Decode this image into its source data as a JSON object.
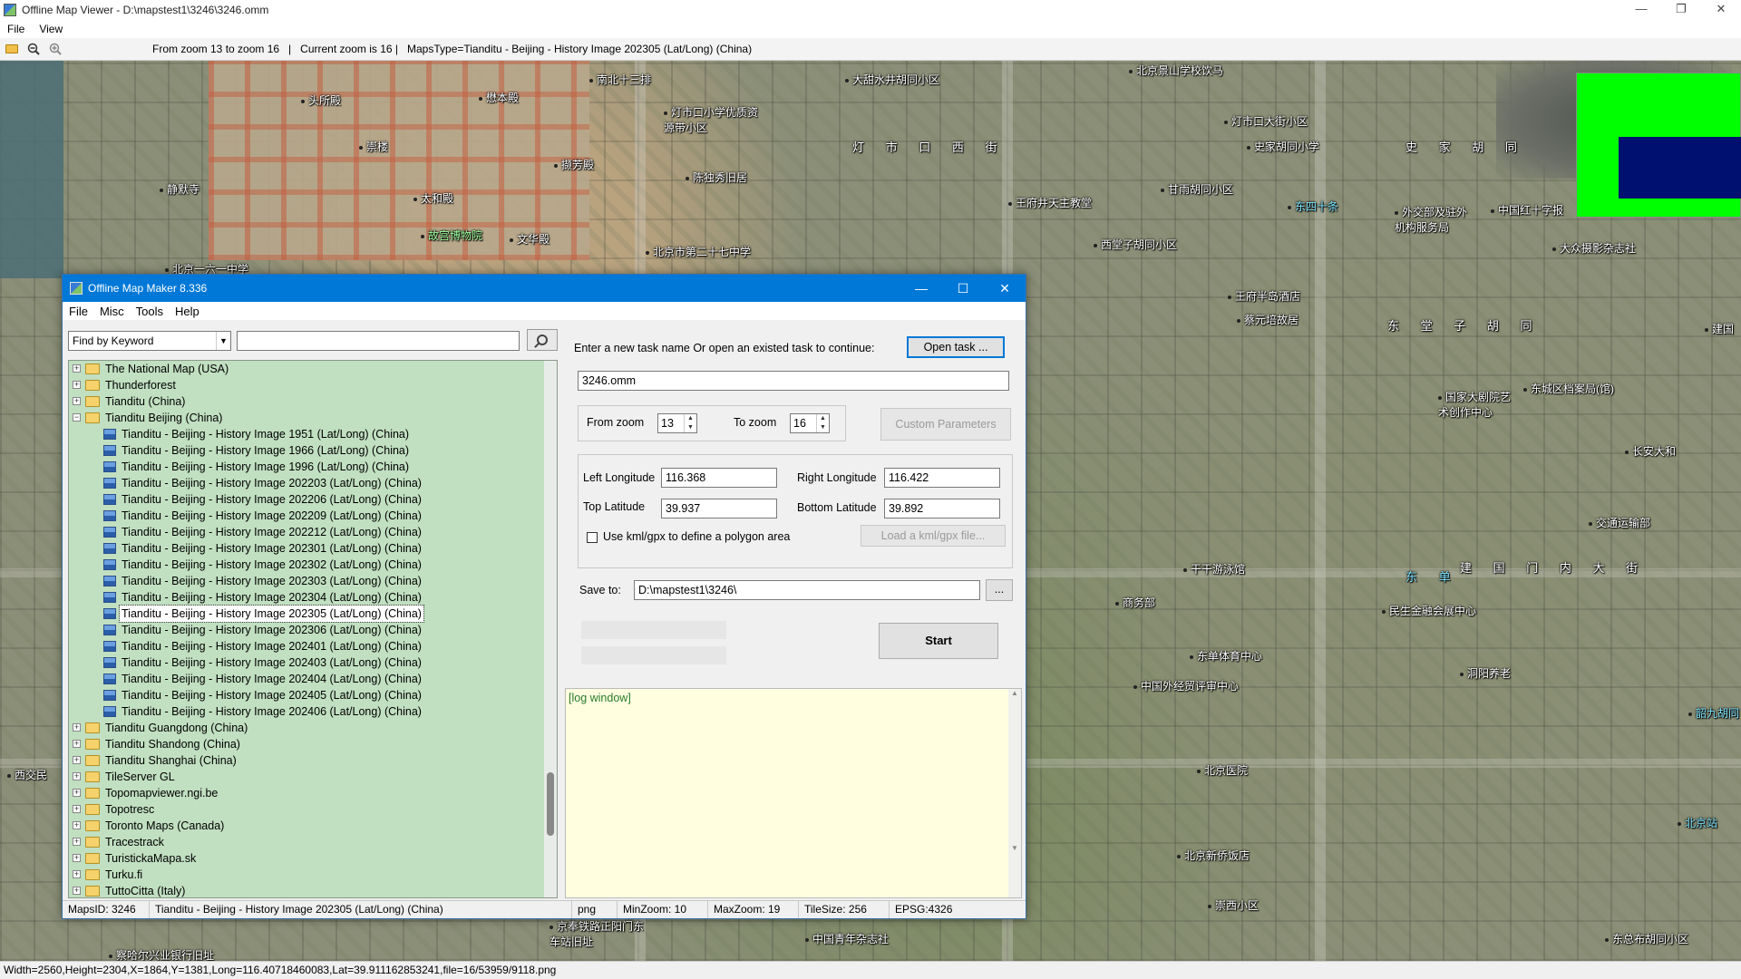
{
  "viewer": {
    "title": "Offline Map Viewer - D:\\mapstest1\\3246\\3246.omm",
    "window_buttons": [
      "—",
      "❐",
      "✕"
    ],
    "menu": [
      "File",
      "View"
    ],
    "toolbar_info": "From zoom 13 to zoom 16   |   Current zoom is 16 |   MapsType=Tianditu - Beijing - History Image 202305 (Lat/Long) (China)",
    "status": "Width=2560,Height=2304,X=1864,Y=1381,Long=116.40718460083,Lat=39.911162853241,file=16/53959/9118.png"
  },
  "map_labels": [
    "头所殿",
    "懋本殿",
    "崇楼",
    "静默寺",
    "太和殿",
    "撷芳殿",
    "故宫博物院",
    "文华殿",
    "北京一六一中学",
    "南北十三排",
    "灯市口小学优质资源带小区",
    "陈独秀旧居",
    "北京市第二十七中学",
    "大甜水井胡同小区",
    "王府井天主教堂",
    "北京景山学校饮马",
    "灯市口大街小区",
    "史家胡同小学",
    "甘雨胡同小区",
    "西堂子胡同小区",
    "外交部及驻外机构服务局",
    "中国红十字报",
    "大众摄影杂志社",
    "王府半岛酒店",
    "蔡元培故居",
    "国家大剧院艺术创作中心",
    "东城区档案局(馆)",
    "长安大和",
    "交通运输部",
    "干干游泳馆",
    "商务部",
    "民生金融会展中心",
    "东单体育中心",
    "中国外经贸评审中心",
    "洞阳养老",
    "北京医院",
    "北京新侨饭店",
    "崇西小区",
    "中国青年杂志社",
    "东总布胡同小区",
    "北京站",
    "京奉铁路正阳门东车站旧址",
    "察哈尔兴业银行旧址",
    "西交民",
    "建国",
    "东四十条",
    "韶九胡同",
    "北京"
  ],
  "big_labels": [
    "灯 市 口 西 街",
    "史 家 胡 同",
    "东 堂 子 胡 同",
    "建 国 门 内 大 街",
    "东 单"
  ],
  "dialog": {
    "title": "Offline Map Maker 8.336",
    "window_buttons": [
      "—",
      "☐",
      "✕"
    ],
    "menu": [
      "File",
      "Misc",
      "Tools",
      "Help"
    ],
    "find_mode": "Find by Keyword",
    "search_value": "",
    "tree": [
      {
        "label": "The National Map (USA)",
        "level": 0,
        "expanded": false
      },
      {
        "label": "Thunderforest",
        "level": 0,
        "expanded": false
      },
      {
        "label": "Tianditu (China)",
        "level": 0,
        "expanded": false
      },
      {
        "label": "Tianditu Beijing (China)",
        "level": 0,
        "expanded": true
      },
      {
        "label": "Tianditu - Beijing - History Image 1951 (Lat/Long) (China)",
        "level": 1
      },
      {
        "label": "Tianditu - Beijing - History Image 1966 (Lat/Long) (China)",
        "level": 1
      },
      {
        "label": "Tianditu - Beijing - History Image 1996 (Lat/Long) (China)",
        "level": 1
      },
      {
        "label": "Tianditu - Beijing - History Image 202203 (Lat/Long) (China)",
        "level": 1
      },
      {
        "label": "Tianditu - Beijing - History Image 202206 (Lat/Long) (China)",
        "level": 1
      },
      {
        "label": "Tianditu - Beijing - History Image 202209 (Lat/Long) (China)",
        "level": 1
      },
      {
        "label": "Tianditu - Beijing - History Image 202212 (Lat/Long) (China)",
        "level": 1
      },
      {
        "label": "Tianditu - Beijing - History Image 202301 (Lat/Long) (China)",
        "level": 1
      },
      {
        "label": "Tianditu - Beijing - History Image 202302 (Lat/Long) (China)",
        "level": 1
      },
      {
        "label": "Tianditu - Beijing - History Image 202303 (Lat/Long) (China)",
        "level": 1
      },
      {
        "label": "Tianditu - Beijing - History Image 202304 (Lat/Long) (China)",
        "level": 1
      },
      {
        "label": "Tianditu - Beijing - History Image 202305 (Lat/Long) (China)",
        "level": 1,
        "selected": true
      },
      {
        "label": "Tianditu - Beijing - History Image 202306 (Lat/Long) (China)",
        "level": 1
      },
      {
        "label": "Tianditu - Beijing - History Image 202401 (Lat/Long) (China)",
        "level": 1
      },
      {
        "label": "Tianditu - Beijing - History Image 202403 (Lat/Long) (China)",
        "level": 1
      },
      {
        "label": "Tianditu - Beijing - History Image 202404 (Lat/Long) (China)",
        "level": 1
      },
      {
        "label": "Tianditu - Beijing - History Image 202405 (Lat/Long) (China)",
        "level": 1
      },
      {
        "label": "Tianditu - Beijing - History Image 202406 (Lat/Long) (China)",
        "level": 1
      },
      {
        "label": "Tianditu Guangdong (China)",
        "level": 0,
        "expanded": false
      },
      {
        "label": "Tianditu Shandong (China)",
        "level": 0,
        "expanded": false
      },
      {
        "label": "Tianditu Shanghai (China)",
        "level": 0,
        "expanded": false
      },
      {
        "label": "TileServer GL",
        "level": 0,
        "expanded": false
      },
      {
        "label": "Topomapviewer.ngi.be",
        "level": 0,
        "expanded": false
      },
      {
        "label": "Topotresc",
        "level": 0,
        "expanded": false
      },
      {
        "label": "Toronto Maps (Canada)",
        "level": 0,
        "expanded": false
      },
      {
        "label": "Tracestrack",
        "level": 0,
        "expanded": false
      },
      {
        "label": "TuristickaMapa.sk",
        "level": 0,
        "expanded": false
      },
      {
        "label": "Turku.fi",
        "level": 0,
        "expanded": false
      },
      {
        "label": "TuttoCitta (Italy)",
        "level": 0,
        "expanded": false
      }
    ],
    "task_prompt": "Enter a new task name Or open an existed task to continue:",
    "open_task_label": "Open task ...",
    "task_name": "3246.omm",
    "from_zoom_label": "From zoom",
    "from_zoom": "13",
    "to_zoom_label": "To zoom",
    "to_zoom": "16",
    "custom_params_label": "Custom Parameters",
    "left_lon_label": "Left Longitude",
    "left_lon": "116.368",
    "right_lon_label": "Right Longitude",
    "right_lon": "116.422",
    "top_lat_label": "Top Latitude",
    "top_lat": "39.937",
    "bottom_lat_label": "Bottom Latitude",
    "bottom_lat": "39.892",
    "kml_checkbox_label": "Use kml/gpx to define a polygon area",
    "kml_checked": false,
    "load_kml_label": "Load a kml/gpx file...",
    "save_to_label": "Save to:",
    "save_to": "D:\\mapstest1\\3246\\",
    "browse_label": "...",
    "start_label": "Start",
    "log_text": "[log window]",
    "status": {
      "maps_id": "MapsID: 3246",
      "maps_name": "Tianditu - Beijing - History Image 202305 (Lat/Long) (China)",
      "format": "png",
      "min_zoom": "MinZoom: 10",
      "max_zoom": "MaxZoom: 19",
      "tile_size": "TileSize: 256",
      "epsg": "EPSG:4326"
    }
  },
  "colors": {
    "dialog_title": "#0078d7",
    "tree_bg": "#c1dfc1",
    "log_bg": "#ffffe0",
    "overview_green": "#00ff00",
    "overview_blue": "#001070"
  }
}
